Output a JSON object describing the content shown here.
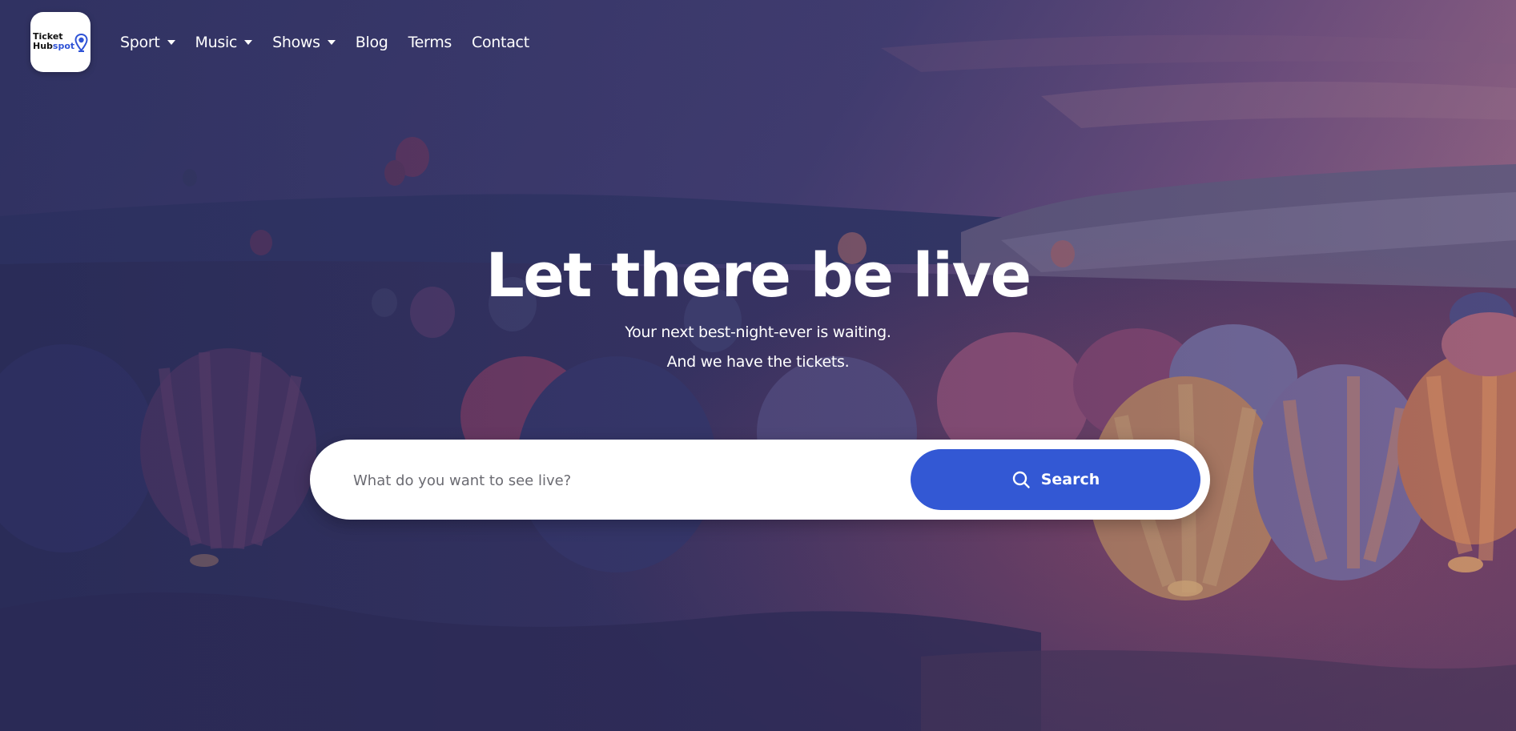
{
  "brand": {
    "logo_line1": "Ticket",
    "logo_line2_a": "Hub",
    "logo_line2_b": "spot",
    "logo_accent_color": "#2f53d6"
  },
  "nav": {
    "items": [
      {
        "label": "Sport",
        "has_dropdown": true
      },
      {
        "label": "Music",
        "has_dropdown": true
      },
      {
        "label": "Shows",
        "has_dropdown": true
      },
      {
        "label": "Blog",
        "has_dropdown": false
      },
      {
        "label": "Terms",
        "has_dropdown": false
      },
      {
        "label": "Contact",
        "has_dropdown": false
      }
    ]
  },
  "hero": {
    "title": "Let there be live",
    "subtitle_line1": "Your next best-night-ever is waiting.",
    "subtitle_line2": "And we have the tickets."
  },
  "search": {
    "placeholder": "What do you want to see live?",
    "button_label": "Search",
    "button_icon": "search-icon",
    "button_color": "#3358d4"
  }
}
